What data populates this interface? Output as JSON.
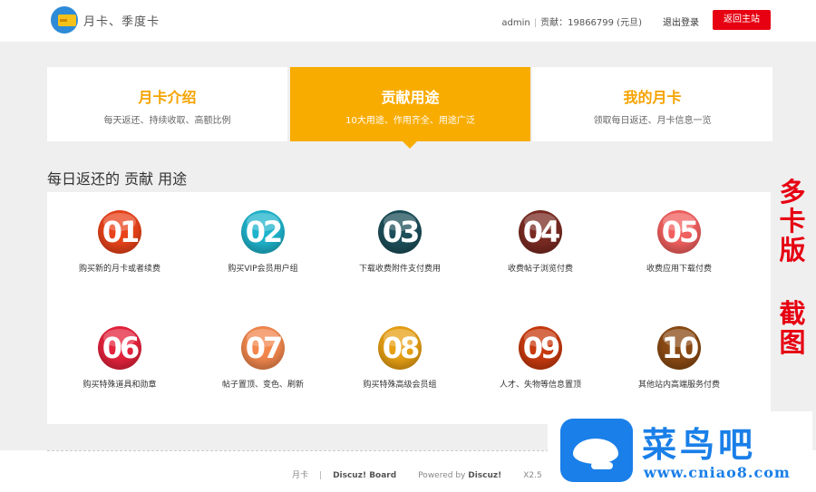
{
  "header": {
    "brand": "月卡、季度卡",
    "username": "admin",
    "contribution": "贡献：19866799 (元旦)",
    "logout": "退出登录",
    "home_button": "返回主站"
  },
  "tabs": [
    {
      "title": "月卡介绍",
      "subtitle": "每天返还、持续收取、高额比例",
      "active": false
    },
    {
      "title": "贡献用途",
      "subtitle": "10大用途、作用齐全、用途广泛",
      "active": true
    },
    {
      "title": "我的月卡",
      "subtitle": "领取每日返还、月卡信息一览",
      "active": false
    }
  ],
  "section_title": "每日返还的 贡献 用途",
  "uses": [
    {
      "num": "01",
      "label": "购买新的月卡或者续费",
      "color": "#e8431a"
    },
    {
      "num": "02",
      "label": "购买VIP会员用户组",
      "color": "#1fb3cc"
    },
    {
      "num": "03",
      "label": "下载收费附件支付费用",
      "color": "#1d4f5a"
    },
    {
      "num": "04",
      "label": "收费帖子浏览付费",
      "color": "#7a2b22"
    },
    {
      "num": "05",
      "label": "收费应用下载付费",
      "color": "#f0605e"
    },
    {
      "num": "06",
      "label": "购买特殊道具和勋章",
      "color": "#e4233c"
    },
    {
      "num": "07",
      "label": "帖子置顶、变色、刷新",
      "color": "#f2874d"
    },
    {
      "num": "08",
      "label": "购买特殊高级会员组",
      "color": "#e8a014"
    },
    {
      "num": "09",
      "label": "人才、失物等信息置顶",
      "color": "#c83a0e"
    },
    {
      "num": "10",
      "label": "其他站内高端服务付费",
      "color": "#8a4a14"
    }
  ],
  "side_text": [
    "多",
    "卡",
    "版",
    "",
    "截",
    "图"
  ],
  "footer": {
    "link1": "月卡",
    "link2": "Discuz! Board",
    "powered_prefix": "Powered by",
    "powered_brand": "Discuz!",
    "version": "X2.5"
  },
  "watermark": {
    "cn": "菜鸟吧",
    "url": "www.cniao8.com"
  }
}
